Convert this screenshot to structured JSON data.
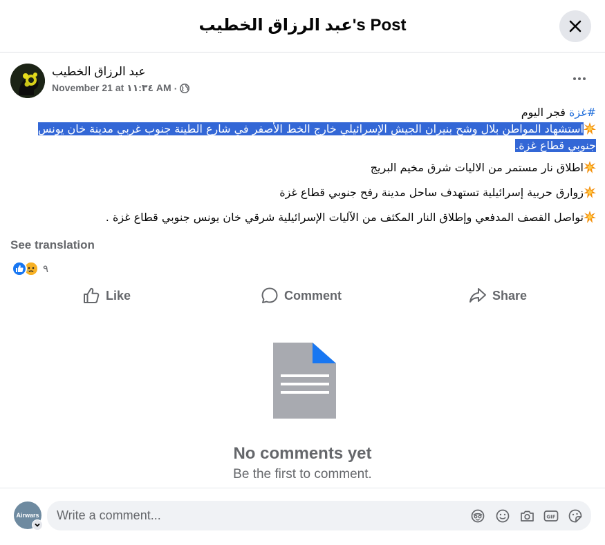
{
  "dialog": {
    "title": "عبد الرزاق الخطيب's Post",
    "close_icon": "close-icon"
  },
  "post": {
    "author": "عبد الرزاق الخطيب",
    "timestamp": "November 21 at ١١:٣٤ AM",
    "separator": "·",
    "privacy_icon": "globe-icon",
    "more_icon": "more-horizontal-icon",
    "hashtag": "#غزة",
    "first_line_text": "  فجر اليوم",
    "highlighted_text": "استشهاد المواطن بلال وشح بنيران الجيش الإسرائيلي خارج الخط الأصفر في شارع الطينة جنوب غربي مدينة خان يونس جنوبي قطاع غزة.",
    "bullet_icon": "collision-emoji-icon",
    "items": [
      "اطلاق نار مستمر من الاليات شرق مخيم البريج",
      "زوارق حربية إسرائيلية تستهدف ساحل مدينة رفح جنوبي قطاع غزة",
      "تواصل القصف المدفعي وإطلاق النار المكثف من الآليات الإسرائيلية شرقي خان يونس جنوبي قطاع غزة ."
    ],
    "see_translation": "See translation",
    "reactions": {
      "icons": [
        "like-reaction-icon",
        "sad-reaction-icon"
      ],
      "count": "٩"
    }
  },
  "actions": {
    "like": "Like",
    "comment": "Comment",
    "share": "Share"
  },
  "comments": {
    "empty_title": "No comments yet",
    "empty_subtitle": "Be the first to comment."
  },
  "composer": {
    "avatar_text": "Airwars",
    "placeholder": "Write a comment...",
    "tools": [
      "avatar-sticker-icon",
      "emoji-icon",
      "camera-icon",
      "gif-icon",
      "sticker-icon"
    ]
  },
  "colors": {
    "highlight": "#3367d6",
    "link": "#216fdb",
    "secondary_text": "#65676b",
    "like_blue": "#1877f2",
    "doc_gray": "#a8aab0",
    "doc_corner": "#1877f2"
  }
}
